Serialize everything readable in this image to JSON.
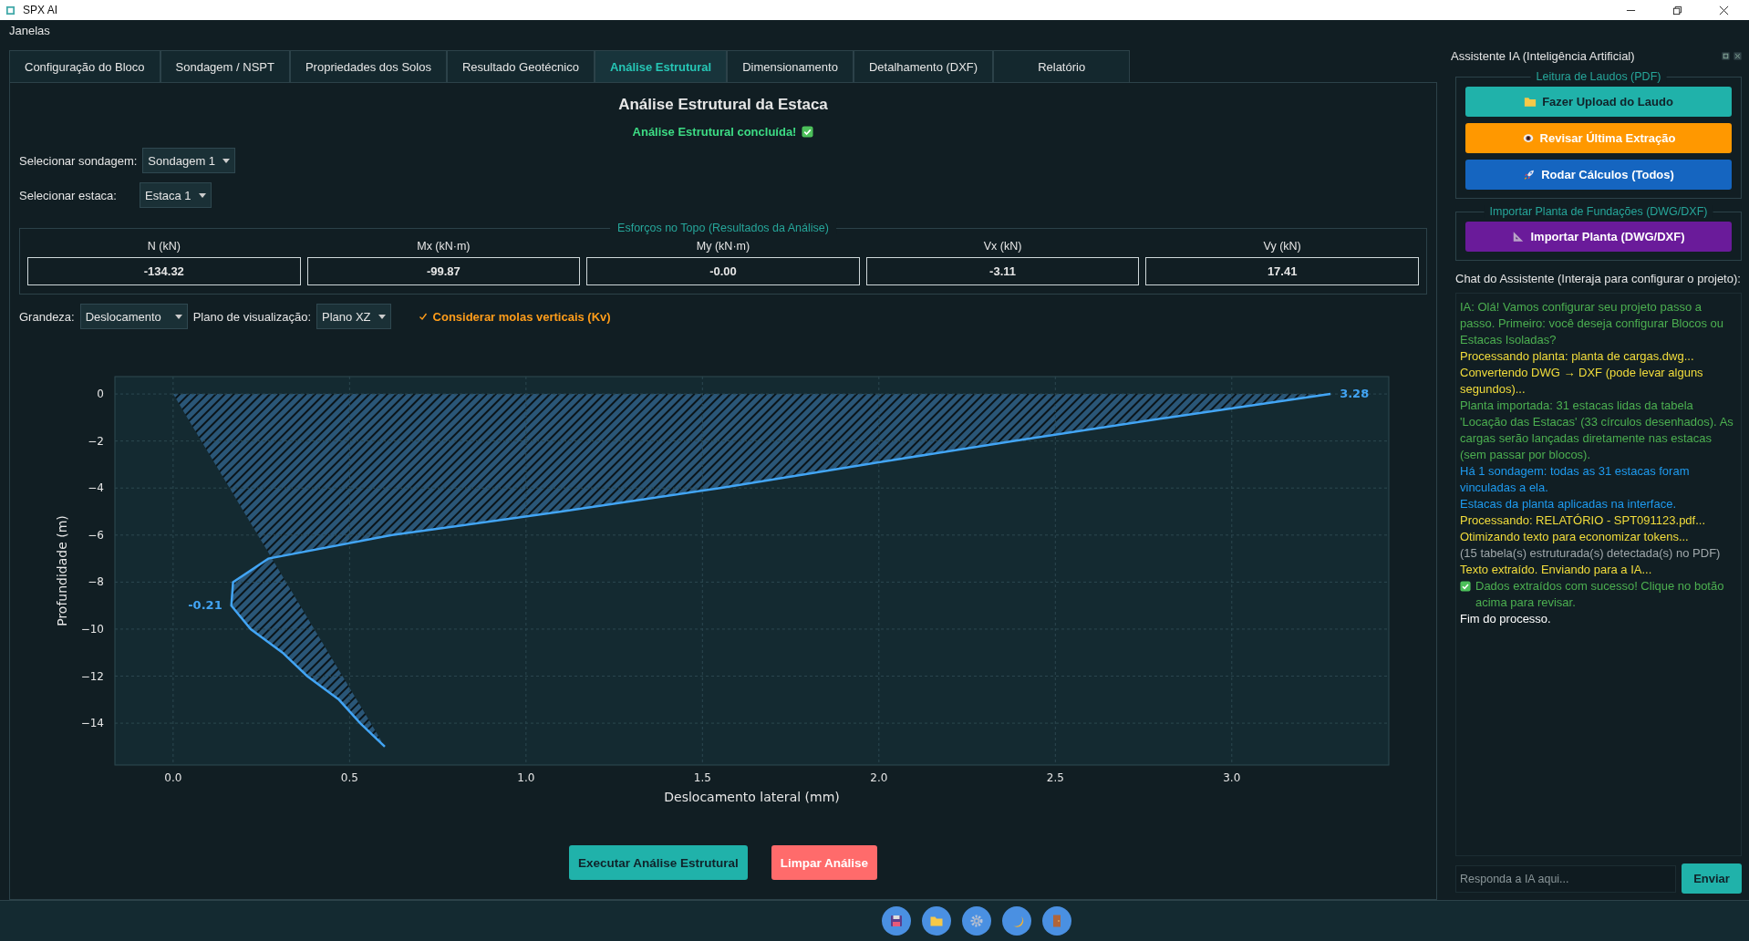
{
  "window": {
    "title": "SPX AI"
  },
  "menu": [
    "Janelas"
  ],
  "tabs": [
    {
      "label": "Configuração do Bloco",
      "selected": false
    },
    {
      "label": "Sondagem / NSPT",
      "selected": false
    },
    {
      "label": "Propriedades dos Solos",
      "selected": false
    },
    {
      "label": "Resultado Geotécnico",
      "selected": false
    },
    {
      "label": "Análise Estrutural",
      "selected": true
    },
    {
      "label": "Dimensionamento",
      "selected": false
    },
    {
      "label": "Detalhamento (DXF)",
      "selected": false
    },
    {
      "label": "Relatório",
      "selected": false
    }
  ],
  "main": {
    "heading": "Análise Estrutural da Estaca",
    "status": "Análise Estrutural concluída!",
    "selectors": [
      {
        "label": "Selecionar sondagem:",
        "value": "Sondagem 1"
      },
      {
        "label": "Selecionar estaca:",
        "value": "Estaca 1"
      }
    ],
    "results": {
      "title": "Esforços no Topo (Resultados da Análise)",
      "columns": [
        {
          "label": "N (kN)",
          "value": "-134.32"
        },
        {
          "label": "Mx (kN·m)",
          "value": "-99.87"
        },
        {
          "label": "My (kN·m)",
          "value": "-0.00"
        },
        {
          "label": "Vx (kN)",
          "value": "-3.11"
        },
        {
          "label": "Vy (kN)",
          "value": "17.41"
        }
      ]
    },
    "options": {
      "quantity_label": "Grandeza:",
      "quantity": "Deslocamento",
      "plane_label": "Plano de visualização:",
      "plane": "Plano XZ",
      "springs": {
        "label": "Considerar molas verticais (Kv)",
        "checked": true
      }
    },
    "chart_data": {
      "type": "line",
      "xlabel": "Deslocamento lateral (mm)",
      "ylabel": "Profundidade (m)",
      "x": [
        3.28,
        2.82,
        2.38,
        1.96,
        1.55,
        1.1,
        0.62,
        0.27,
        0.17,
        0.165,
        0.22,
        0.31,
        0.38,
        0.47,
        0.53,
        0.6
      ],
      "grid": true,
      "series": [
        {
          "color": "#42a5f5",
          "values": [
            0,
            -1,
            -2,
            -3,
            -4,
            -5,
            -6,
            -7,
            -8,
            -9,
            -10,
            -11,
            -12,
            -13,
            -14,
            -15
          ]
        }
      ],
      "xlim": [
        -0.165,
        3.445
      ],
      "ylim": [
        -15.78,
        0.74
      ],
      "xticks": [
        {
          "value": 0,
          "label": "0.0"
        },
        {
          "value": 0.5,
          "label": "0.5"
        },
        {
          "value": 1,
          "label": "1.0"
        },
        {
          "value": 1.5,
          "label": "1.5"
        },
        {
          "value": 2,
          "label": "2.0"
        },
        {
          "value": 2.5,
          "label": "2.5"
        },
        {
          "value": 3,
          "label": "3.0"
        }
      ],
      "yticks": [
        {
          "value": 0,
          "label": "0"
        },
        {
          "value": -2,
          "label": "−2"
        },
        {
          "value": -4,
          "label": "−4"
        },
        {
          "value": -6,
          "label": "−6"
        },
        {
          "value": -8,
          "label": "−8"
        },
        {
          "value": -10,
          "label": "−10"
        },
        {
          "value": -12,
          "label": "−12"
        },
        {
          "value": -14,
          "label": "−14"
        }
      ],
      "annotations": [
        {
          "text": "3.28",
          "x": 3.28,
          "y": 0
        },
        {
          "text": "-0.21",
          "x": 0.165,
          "y": -9
        }
      ]
    },
    "buttons": [
      {
        "label": "Executar Análise Estrutural",
        "kind": "primary"
      },
      {
        "label": "Limpar Análise",
        "kind": "danger"
      }
    ]
  },
  "assistant": {
    "title": "Assistente IA (Inteligência Artificial)",
    "groups": [
      {
        "title": "Leitura de Laudos (PDF)",
        "buttons": [
          {
            "label": "Fazer Upload do Laudo",
            "kind": "upload"
          },
          {
            "label": "Revisar Última Extração",
            "kind": "review"
          },
          {
            "label": "Rodar Cálculos (Todos)",
            "kind": "run"
          }
        ]
      },
      {
        "title": "Importar Planta de Fundações (DWG/DXF)",
        "buttons": [
          {
            "label": "Importar Planta (DWG/DXF)",
            "kind": "import"
          }
        ]
      }
    ],
    "chat_label": "Chat do Assistente (Interaja para configurar o projeto):",
    "messages": [
      {
        "text": "IA: Olá! Vamos configurar seu projeto passo a passo. Primeiro: você deseja configurar Blocos ou Estacas Isoladas?",
        "kind": "ai"
      },
      {
        "text": "Processando planta: planta de cargas.dwg...",
        "kind": "process"
      },
      {
        "text": "Convertendo DWG → DXF (pode levar alguns segundos)...",
        "kind": "process"
      },
      {
        "text": "Planta importada: 31 estacas lidas da tabela 'Locação das Estacas' (33 círculos desenhados). As cargas serão lançadas diretamente nas estacas (sem passar por blocos).",
        "kind": "ai"
      },
      {
        "text": "Há 1 sondagem: todas as 31 estacas foram vinculadas a ela.",
        "kind": "info"
      },
      {
        "text": "Estacas da planta aplicadas na interface.",
        "kind": "info"
      },
      {
        "text": "Processando: RELATÓRIO - SPT091123.pdf...",
        "kind": "process"
      },
      {
        "text": "Otimizando texto para economizar tokens...",
        "kind": "process"
      },
      {
        "text": "(15 tabela(s) estruturada(s) detectada(s) no PDF)",
        "kind": "muted"
      },
      {
        "text": "Texto extraído. Enviando para a IA...",
        "kind": "process"
      },
      {
        "text": "Dados extraídos com sucesso! Clique no botão acima para revisar.",
        "kind": "success"
      },
      {
        "text": "Fim do processo.",
        "kind": "plain"
      }
    ],
    "input": {
      "placeholder": "Responda a IA aqui..."
    },
    "send": "Enviar"
  },
  "toolbar": [
    {
      "kind": "save"
    },
    {
      "kind": "folder"
    },
    {
      "kind": "gear"
    },
    {
      "kind": "moon"
    },
    {
      "kind": "door"
    }
  ]
}
